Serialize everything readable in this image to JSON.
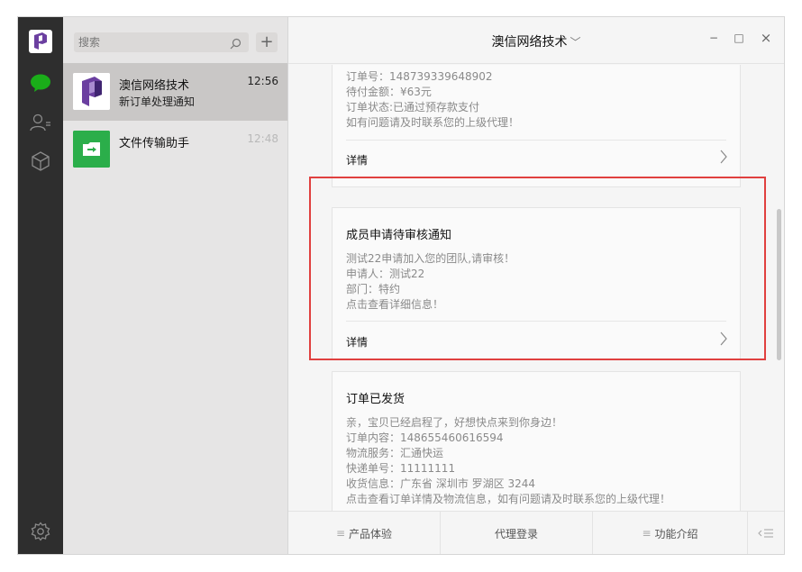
{
  "colors": {
    "nav_bg": "#2e2e2e",
    "wechat_green": "#1aad19",
    "highlight_red": "#e0403f",
    "purple_logo": "#6b3fa0",
    "file_helper_green": "#2bae4a"
  },
  "nav": {
    "icons": [
      "app-logo-icon",
      "chat-bubble-icon",
      "contacts-icon",
      "box-icon",
      "settings-gear-icon"
    ]
  },
  "search": {
    "placeholder": "搜索"
  },
  "chat_list": [
    {
      "name": "澳信网络技术",
      "preview": "新订单处理通知",
      "time": "12:56",
      "active": true
    },
    {
      "name": "文件传输助手",
      "preview": "",
      "time": "12:48",
      "active": false
    }
  ],
  "header": {
    "title": "澳信网络技术",
    "minimize": "−",
    "maximize": "□",
    "close": "×"
  },
  "cards": [
    {
      "lines": [
        "订单号：148739339648902",
        "待付金额：¥63元",
        "订单状态:已通过预存款支付",
        "如有问题请及时联系您的上级代理！"
      ],
      "detail": "详情"
    },
    {
      "title": "成员申请待审核通知",
      "lines": [
        "测试22申请加入您的团队,请审核！",
        "申请人：测试22",
        "部门：特约",
        "点击查看详细信息！"
      ],
      "detail": "详情"
    },
    {
      "title": "订单已发货",
      "lines": [
        "亲，宝贝已经启程了，好想快点来到你身边！",
        "订单内容：148655460616594",
        "物流服务：汇通快运",
        "快递单号：11111111",
        "收货信息：广东省 深圳市 罗湖区 3244",
        "点击查看订单详情及物流信息，如有问题请及时联系您的上级代理！"
      ]
    }
  ],
  "bottom_menu": [
    {
      "label": "产品体验",
      "has_submenu": true
    },
    {
      "label": "代理登录",
      "has_submenu": false
    },
    {
      "label": "功能介绍",
      "has_submenu": true
    }
  ]
}
